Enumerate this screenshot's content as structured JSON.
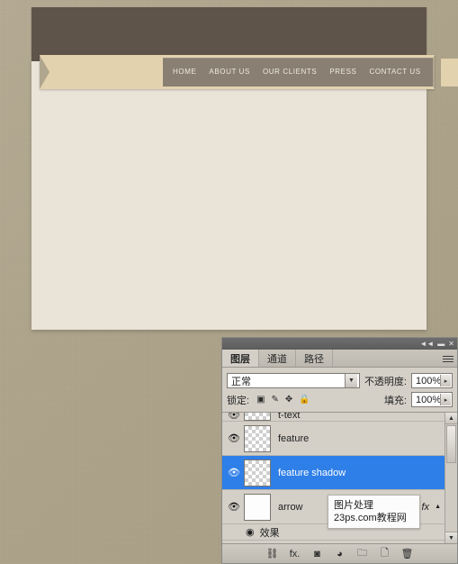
{
  "mockup": {
    "nav_items": [
      {
        "label": "HOME"
      },
      {
        "label": "ABOUT US"
      },
      {
        "label": "OUR CLIENTS"
      },
      {
        "label": "PRESS"
      },
      {
        "label": "CONTACT US"
      }
    ],
    "colors": {
      "header_band": "#5f5449",
      "content_panel": "#eae3d7",
      "ribbon": "#e3d2ae",
      "nav_bar": "#897f72",
      "background": "#b0a68e"
    }
  },
  "panel": {
    "titlebar": {
      "collapse": "◄◄",
      "minimize": "▬",
      "close": "✕"
    },
    "tabs": [
      {
        "label": "图层",
        "active": true
      },
      {
        "label": "通道",
        "active": false
      },
      {
        "label": "路径",
        "active": false
      }
    ],
    "menu_icon": "panel-menu-icon",
    "blend_mode": {
      "value": "正常",
      "arrow": "▼"
    },
    "opacity": {
      "label": "不透明度:",
      "value": "100%",
      "arrow": "▸"
    },
    "lock": {
      "label": "锁定:",
      "icons": [
        "▣",
        "✎",
        "✥",
        "🔒"
      ]
    },
    "fill": {
      "label": "填充:",
      "value": "100%",
      "arrow": "▸"
    },
    "layers": [
      {
        "name": "t-text",
        "visible": true,
        "selected": false,
        "clipped": true,
        "thumb": "transparent"
      },
      {
        "name": "feature",
        "visible": true,
        "selected": false,
        "clipped": false,
        "thumb": "transparent"
      },
      {
        "name": "feature shadow",
        "visible": true,
        "selected": true,
        "clipped": false,
        "thumb": "transparent"
      },
      {
        "name": "arrow",
        "visible": true,
        "selected": false,
        "clipped": false,
        "thumb": "plain"
      }
    ],
    "effects_row": {
      "eye": "◉",
      "label": "效果"
    },
    "scrollbar": {
      "up": "▲",
      "down": "▼"
    },
    "bottom_tools": [
      {
        "name": "link-layers-icon",
        "glyph": "⛓"
      },
      {
        "name": "layer-style-icon",
        "glyph": "fx."
      },
      {
        "name": "layer-mask-icon",
        "glyph": "◙"
      },
      {
        "name": "adjustment-layer-icon",
        "glyph": "◕"
      },
      {
        "name": "new-group-icon",
        "glyph": "🗀"
      },
      {
        "name": "new-layer-icon",
        "glyph": "🗋"
      },
      {
        "name": "delete-layer-icon",
        "glyph": "🗑"
      }
    ],
    "eye_glyph": "👁",
    "fx_badge": "fx",
    "fx_arrow": "▲"
  },
  "watermark": {
    "line1": "图片处理",
    "line2": "23ps.com教程网"
  }
}
